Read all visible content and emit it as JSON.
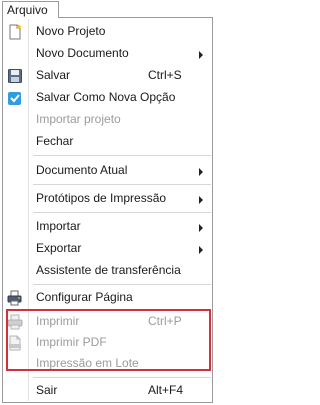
{
  "menubar": {
    "tab_label": "Arquivo"
  },
  "menu": {
    "novo_projeto": "Novo Projeto",
    "novo_documento": "Novo Documento",
    "salvar": "Salvar",
    "salvar_shortcut": "Ctrl+S",
    "salvar_como": "Salvar Como Nova Opção",
    "importar_projeto": "Importar projeto",
    "fechar": "Fechar",
    "documento_atual": "Documento Atual",
    "prototipos": "Protótipos de Impressão",
    "importar": "Importar",
    "exportar": "Exportar",
    "assistente": "Assistente de transferência",
    "configurar_pagina": "Configurar Página",
    "imprimir": "Imprimir",
    "imprimir_shortcut": "Ctrl+P",
    "imprimir_pdf": "Imprimir PDF",
    "impressao_lote": "Impressão em Lote",
    "sair": "Sair",
    "sair_shortcut": "Alt+F4"
  },
  "colors": {
    "highlight_border": "#d32f3c",
    "disabled_text": "#9b9b9b"
  }
}
